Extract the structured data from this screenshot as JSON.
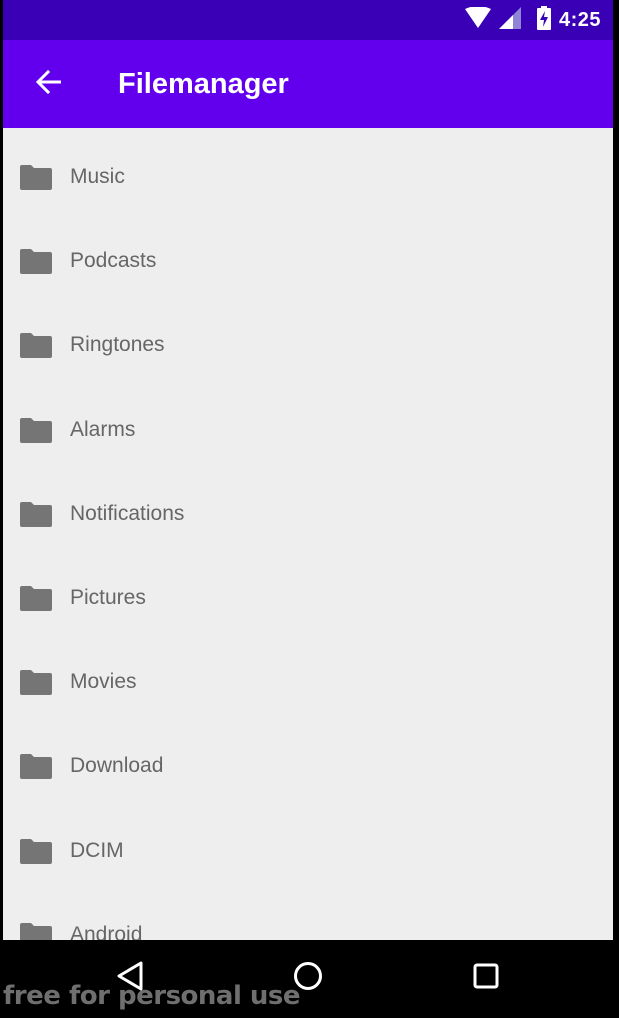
{
  "status_bar": {
    "time": "4:25",
    "icons": [
      "wifi-icon",
      "cell-signal-icon",
      "battery-charging-icon"
    ]
  },
  "app_bar": {
    "title": "Filemanager",
    "back_icon": "arrow-back-icon"
  },
  "folders": [
    {
      "label": "Music",
      "icon": "folder-icon"
    },
    {
      "label": "Podcasts",
      "icon": "folder-icon"
    },
    {
      "label": "Ringtones",
      "icon": "folder-icon"
    },
    {
      "label": "Alarms",
      "icon": "folder-icon"
    },
    {
      "label": "Notifications",
      "icon": "folder-icon"
    },
    {
      "label": "Pictures",
      "icon": "folder-icon"
    },
    {
      "label": "Movies",
      "icon": "folder-icon"
    },
    {
      "label": "Download",
      "icon": "folder-icon"
    },
    {
      "label": "DCIM",
      "icon": "folder-icon"
    },
    {
      "label": "Android",
      "icon": "folder-icon"
    }
  ],
  "nav_bar": {
    "icons": [
      "back-triangle-icon",
      "home-circle-icon",
      "recents-square-icon"
    ]
  },
  "watermark": "free for personal use",
  "colors": {
    "status_bar": "#3a00b6",
    "app_bar": "#6200ee",
    "background": "#eeeeee",
    "folder": "#757575",
    "label": "#666666"
  }
}
